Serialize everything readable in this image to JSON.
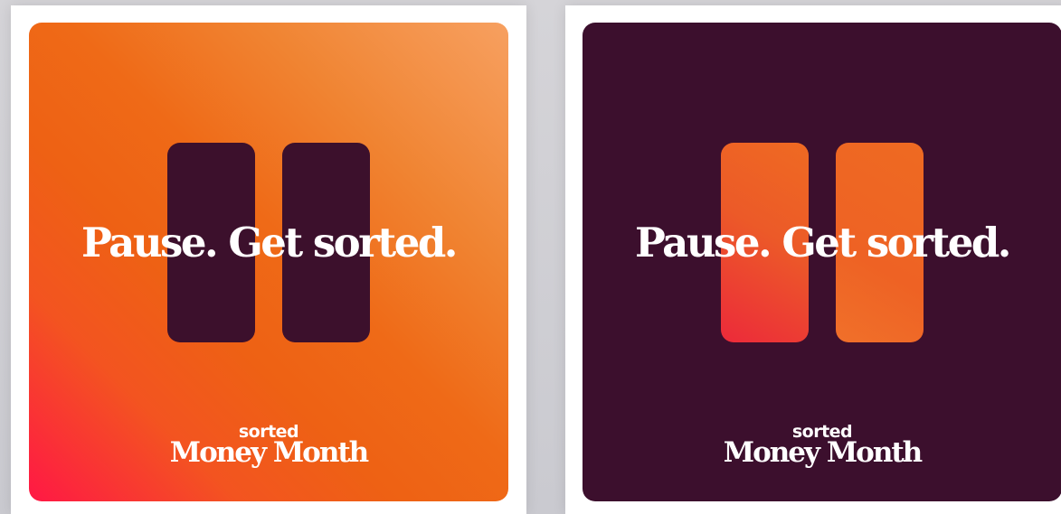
{
  "colors": {
    "page_background": "#d1d1d6",
    "frame": "#ffffff",
    "orange_light": "#f7a060",
    "orange": "#ef6a17",
    "pink_red": "#ff1845",
    "plum": "#3c0f2d",
    "text": "#ffffff"
  },
  "cards": [
    {
      "variant": "orange-background",
      "icon": "pause-icon",
      "headline": "Pause. Get sorted.",
      "logo_top": "sorted",
      "logo_bottom": "Money Month"
    },
    {
      "variant": "plum-background",
      "icon": "pause-icon",
      "headline": "Pause. Get sorted.",
      "logo_top": "sorted",
      "logo_bottom": "Money Month"
    }
  ]
}
